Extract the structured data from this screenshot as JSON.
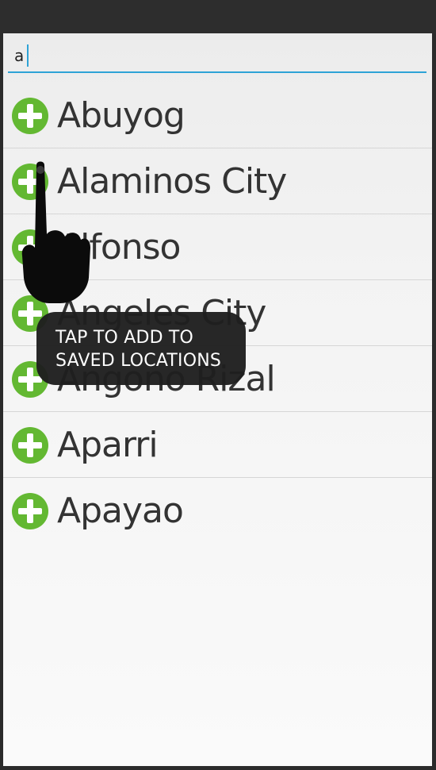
{
  "search": {
    "value": "a"
  },
  "locations": [
    {
      "label": "Abuyog"
    },
    {
      "label": "Alaminos City"
    },
    {
      "label": "Alfonso"
    },
    {
      "label": "Angeles City"
    },
    {
      "label": "Angono Rizal"
    },
    {
      "label": "Aparri"
    },
    {
      "label": "Apayao"
    }
  ],
  "tooltip": {
    "line1": "TAP TO ADD TO",
    "line2": "SAVED LOCATIONS"
  },
  "icons": {
    "add": "plus-circle-icon",
    "hand": "pointing-hand-icon"
  },
  "colors": {
    "accent": "#2ea3d6",
    "add_icon": "#63b832"
  }
}
